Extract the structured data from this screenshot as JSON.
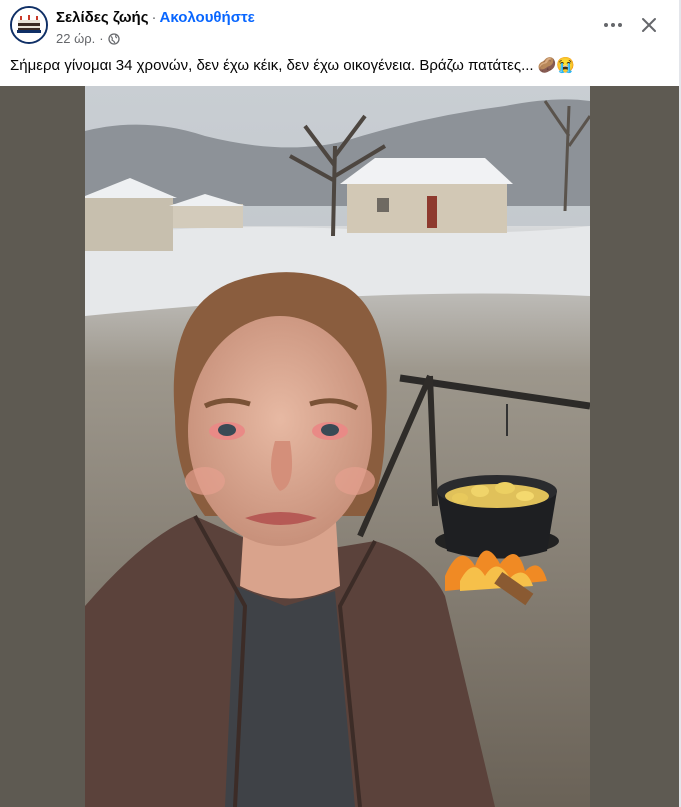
{
  "post": {
    "page_name": "Σελίδες ζωής",
    "separator": "·",
    "follow_label": "Ακολουθήστε",
    "time": "22 ώρ.",
    "time_separator": "·",
    "privacy_icon": "globe-icon",
    "caption": "Σήμερα γίνομαι 34 χρονών, δεν έχω κέικ, δεν έχω οικογένεια. Βράζω πατάτες...",
    "caption_emojis": "🥔😭",
    "more_icon": "more-horizontal-icon",
    "close_icon": "close-icon"
  },
  "colors": {
    "accent": "#0866ff",
    "text": "#050505",
    "secondary_text": "#65676b",
    "media_background": "#5e5a52"
  }
}
